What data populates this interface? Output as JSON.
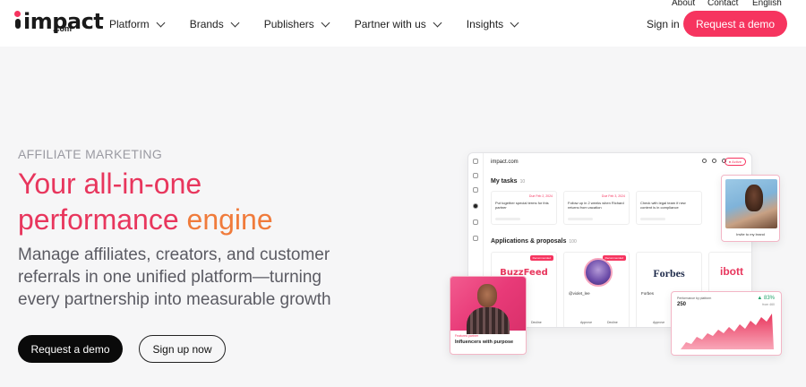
{
  "brand": {
    "logo_word": "impact",
    "logo_suffix": ".com"
  },
  "nav": {
    "items": [
      {
        "label": "Platform"
      },
      {
        "label": "Brands"
      },
      {
        "label": "Publishers"
      },
      {
        "label": "Partner with us"
      },
      {
        "label": "Insights"
      }
    ]
  },
  "utility": {
    "about": "About",
    "contact": "Contact",
    "language": "English"
  },
  "header": {
    "sign_in": "Sign in",
    "request_demo": "Request a demo"
  },
  "hero": {
    "eyebrow": "AFFILIATE MARKETING",
    "headline_line1": "Your all-in-one",
    "headline_line2a": "performance ",
    "headline_line2b": "engine",
    "subhead": "Manage affiliates, creators, and customer referrals in one unified platform—turning every partnership into measurable growth",
    "cta_primary": "Request a demo",
    "cta_secondary": "Sign up now"
  },
  "mockup": {
    "app_name": "impact.com",
    "status_pill": "● Active",
    "tasks_title": "My tasks",
    "tasks_count": "10",
    "tasks": [
      {
        "due": "Due Feb 2, 2024",
        "text": "Put together special terms for this partner"
      },
      {
        "due": "Due Feb 3, 2024",
        "text": "Follow up in 2 weeks when Richard returns from vacation"
      },
      {
        "due": "",
        "text": "Check with legal team if new content is in compliance"
      }
    ],
    "apps_title": "Applications & proposals",
    "apps_count": "100",
    "apps": [
      {
        "name": "BuzzFeed",
        "tag": "Recommended",
        "action1": "",
        "action2": "Decline"
      },
      {
        "name": "@violet_lee",
        "tag": "Recommended",
        "action1": "Approve",
        "action2": "Decline"
      },
      {
        "name": "Forbes",
        "tag": "",
        "action1": "Approve",
        "action2": ""
      },
      {
        "name": "ibott",
        "tag": "",
        "action1": "",
        "action2": ""
      }
    ],
    "invite_label": "Invite to my brand",
    "influencer_kicker": "Featured partner",
    "influencer_title": "Influencers with purpose",
    "perf_title": "Performance by platform",
    "perf_value": "250",
    "perf_change": "▲ 83%",
    "perf_change_sub": "from 460"
  },
  "colors": {
    "accent": "#f6345f",
    "headline_orange": "#f07b3b",
    "dark_button": "#0a0a0a"
  }
}
